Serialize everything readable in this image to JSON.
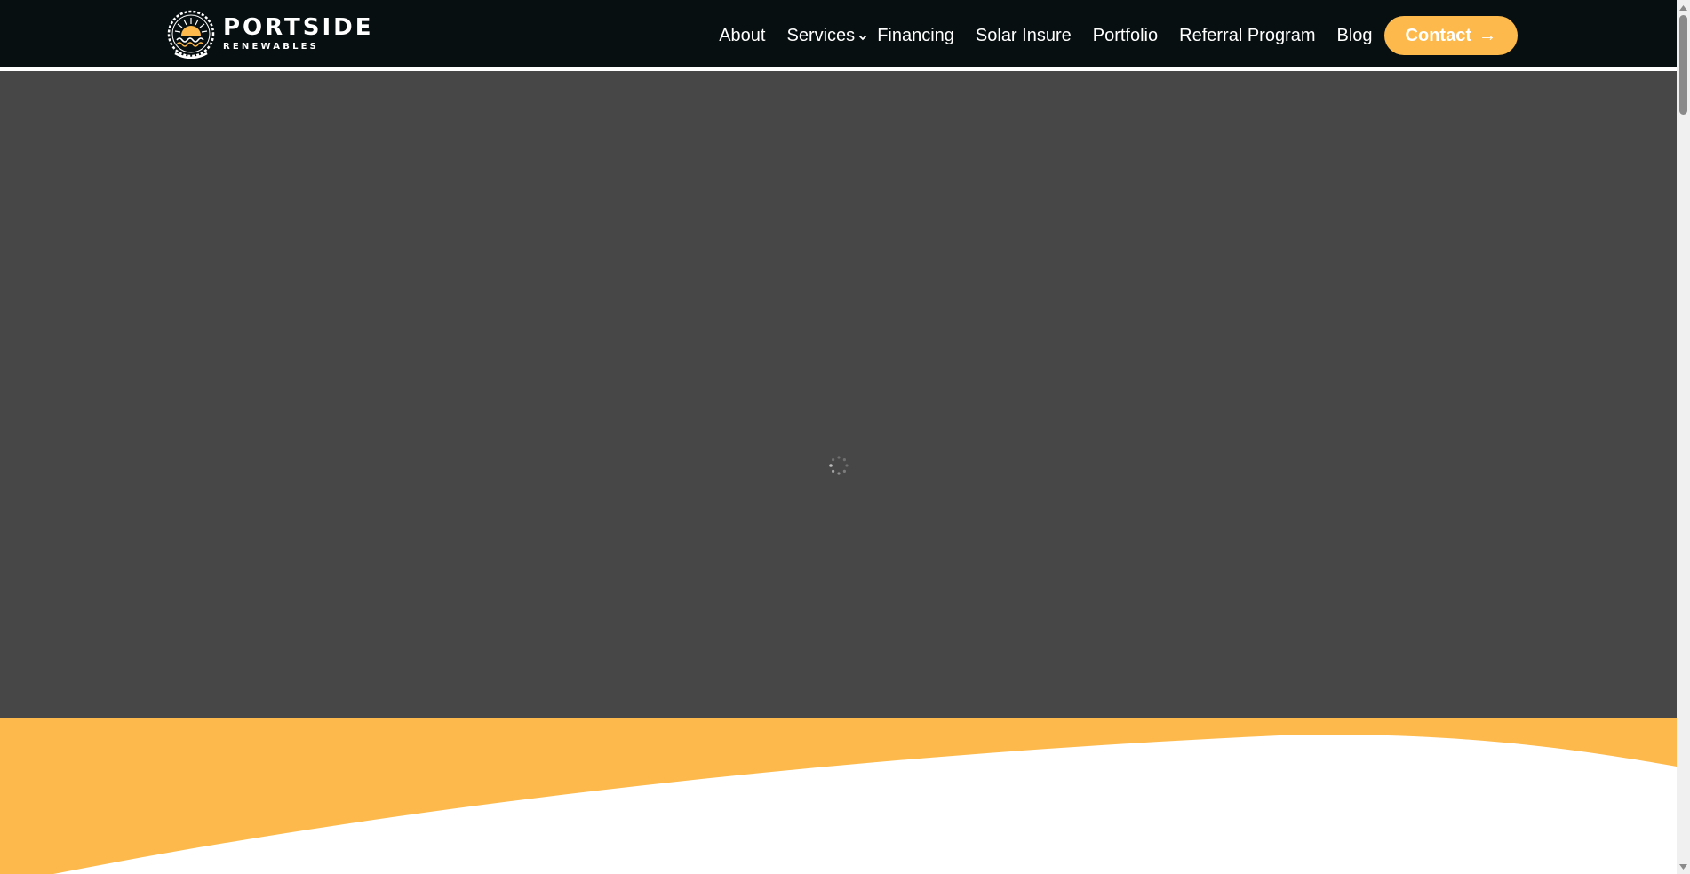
{
  "brand": {
    "name": "PORTSIDE",
    "tagline": "RENEWABLES",
    "accent_color": "#fdb94b",
    "header_bg": "#080f10",
    "hero_bg": "#474747"
  },
  "nav": {
    "items": [
      {
        "label": "About"
      },
      {
        "label": "Services",
        "has_dropdown": true
      },
      {
        "label": "Financing"
      },
      {
        "label": "Solar Insure"
      },
      {
        "label": "Portfolio"
      },
      {
        "label": "Referral Program"
      },
      {
        "label": "Blog"
      }
    ],
    "cta_label": "Contact",
    "cta_icon": "arrow-right-icon"
  },
  "hero": {
    "state": "loading",
    "spinner_icon": "loading-spinner-icon"
  }
}
